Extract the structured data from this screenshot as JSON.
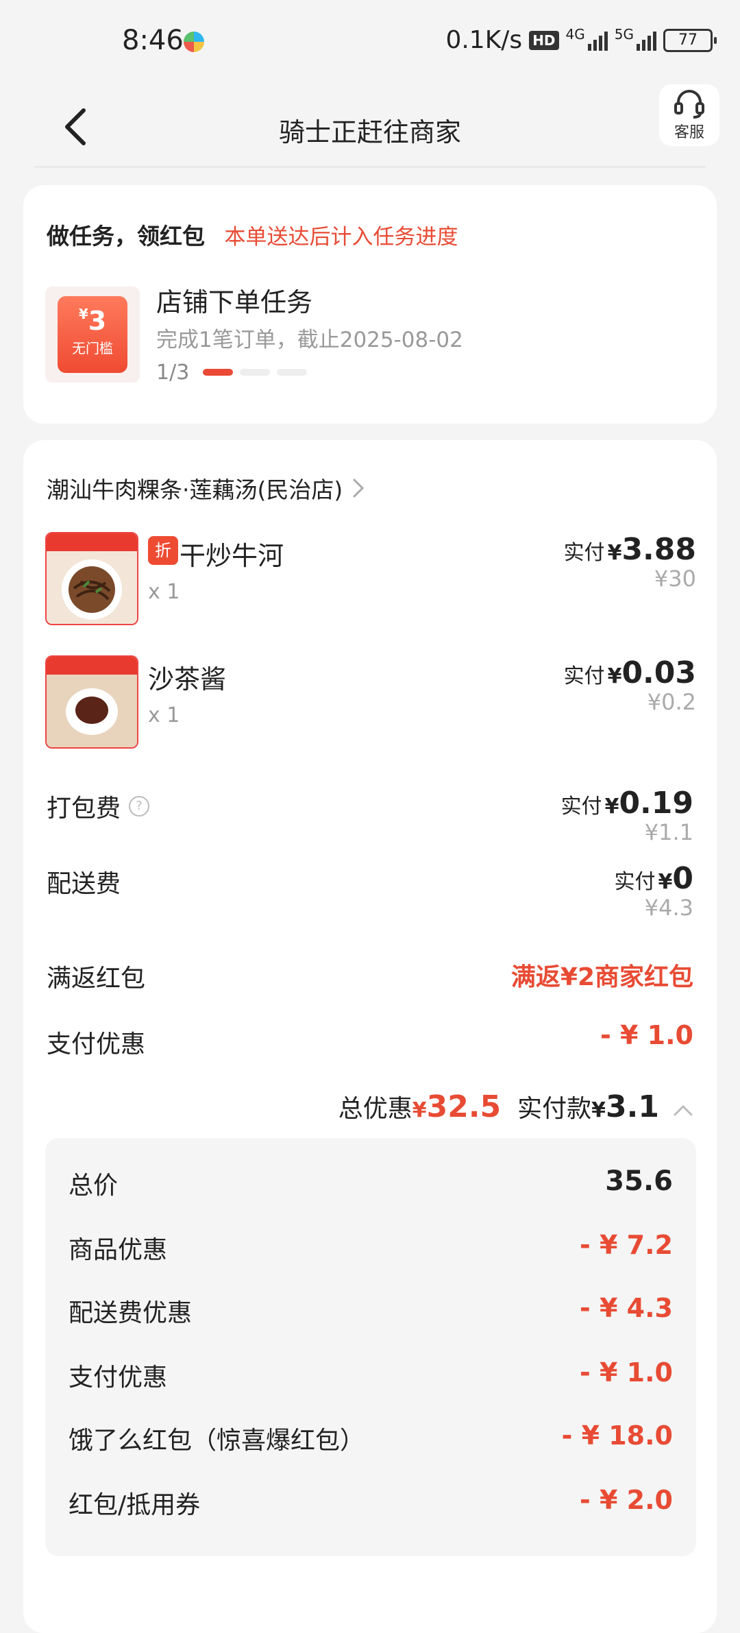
{
  "status_bar": {
    "time": "8:46",
    "network_speed": "0.1K/s",
    "hd_badge": "HD",
    "net1": "4G",
    "net2": "5G",
    "battery": "77"
  },
  "header": {
    "title": "骑士正赶往商家",
    "service_label": "客服",
    "icons": [
      "back-arrow-icon",
      "headset-icon"
    ]
  },
  "task": {
    "title": "做任务，领红包",
    "note": "本单送达后计入任务进度",
    "coupon_currency": "¥",
    "coupon_amount": "3",
    "coupon_label": "无门槛",
    "task_name": "店铺下单任务",
    "task_desc": "完成1笔订单，截止2025-08-02",
    "progress_text": "1/3",
    "progress_current": 1,
    "progress_total": 3
  },
  "order": {
    "shop_name": "潮汕牛肉粿条·莲藕汤(民治店)",
    "items": [
      {
        "name": "干炒牛河",
        "tag": "折",
        "qty": "x 1",
        "paid_label": "实付",
        "currency": "¥",
        "paid": "3.88",
        "original": "¥30"
      },
      {
        "name": "沙茶酱",
        "qty": "x 1",
        "paid_label": "实付",
        "currency": "¥",
        "paid": "0.03",
        "original": "¥0.2"
      }
    ],
    "packing": {
      "label": "打包费",
      "help": "?",
      "paid_label": "实付",
      "currency": "¥",
      "paid": "0.19",
      "original": "¥1.1"
    },
    "delivery": {
      "label": "配送费",
      "paid_label": "实付",
      "currency": "¥",
      "paid": "0",
      "original": "¥4.3"
    },
    "cashback": {
      "label": "满返红包",
      "value": "满返¥2商家红包"
    },
    "pay_discount": {
      "label": "支付优惠",
      "value": "- ¥ 1.0"
    },
    "summary": {
      "discount_label": "总优惠",
      "currency": "¥",
      "discount_value": "32.5",
      "paid_label": "实付款",
      "paid_value": "3.1"
    },
    "breakdown": [
      {
        "label": "总价",
        "value": "35.6"
      },
      {
        "label": "商品优惠",
        "value": "- ¥ 7.2"
      },
      {
        "label": "配送费优惠",
        "value": "- ¥ 4.3"
      },
      {
        "label": "支付优惠",
        "value": "- ¥ 1.0"
      },
      {
        "label": "饿了么红包（惊喜爆红包）",
        "value": "- ¥ 18.0"
      },
      {
        "label": "红包/抵用券",
        "value": "- ¥ 2.0"
      }
    ]
  },
  "colors": {
    "accent": "#e84b34",
    "background": "#f4f4f4",
    "card": "#ffffff"
  }
}
